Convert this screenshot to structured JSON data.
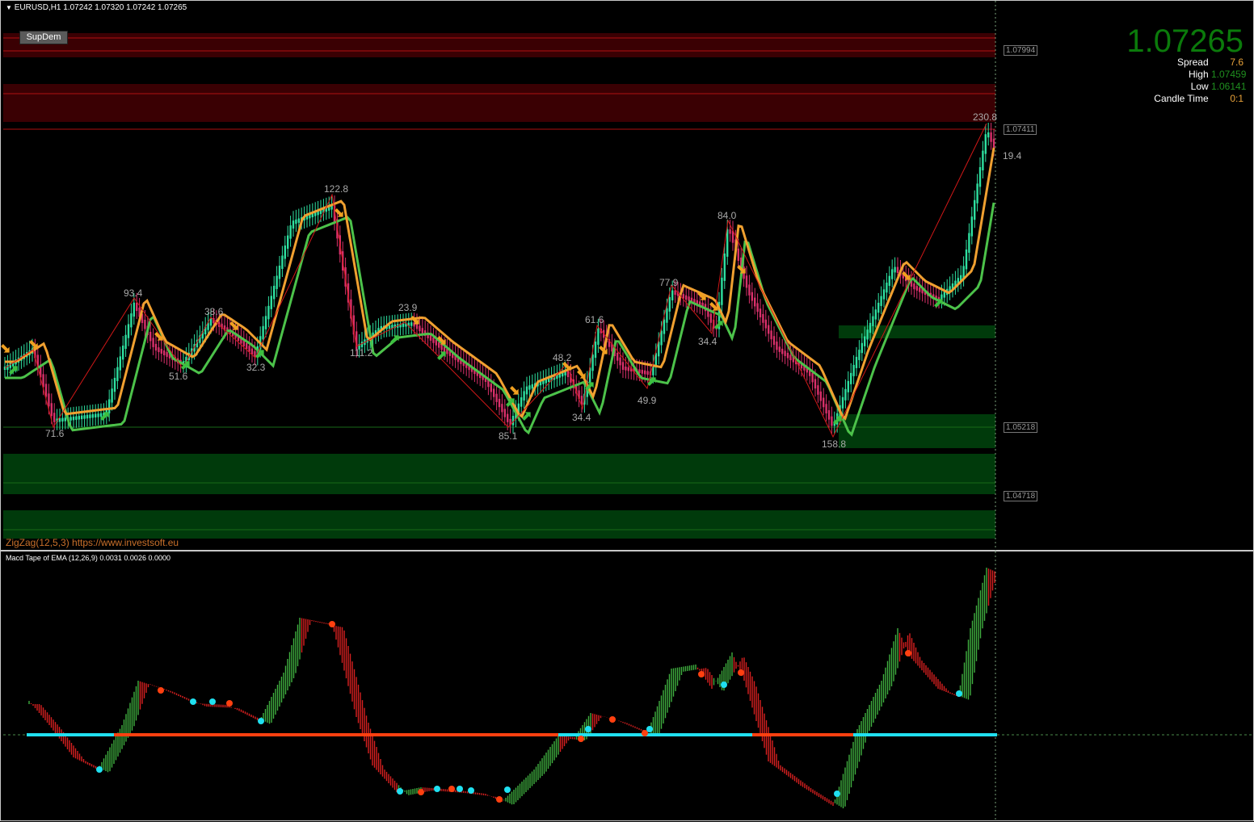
{
  "window": {
    "header": "EURUSD,H1  1.07242 1.07320 1.07242 1.07265",
    "indicator_button": "SupDem",
    "footer": "ZigZag(12,5,3) https://www.investsoft.eu"
  },
  "price_panel": {
    "current_price": "1.07265",
    "rows": [
      {
        "label": "Spread",
        "value": "7.6",
        "color": "#e8a23a"
      },
      {
        "label": "High",
        "value": "1.07459",
        "color": "#1f8f1f"
      },
      {
        "label": "Low",
        "value": "1.06141",
        "color": "#1f8f1f"
      },
      {
        "label": "Candle Time",
        "value": "0:1",
        "color": "#e8a23a"
      }
    ]
  },
  "price_tags": [
    "1.07994",
    "1.07411",
    "1.05218",
    "1.04718"
  ],
  "zigzag_labels": [
    "93.4",
    "71.6",
    "51.6",
    "38.6",
    "32.3",
    "122.8",
    "111.2",
    "23.9",
    "85.1",
    "48.2",
    "61.6",
    "34.4",
    "49.9",
    "77.9",
    "34.4",
    "84.0",
    "158.8",
    "230.8",
    "19.4"
  ],
  "subwindow": {
    "title": "Macd Tape of EMA (12,26,9) 0.0031 0.0026 0.0000"
  },
  "colors": {
    "supply_zone": "#3a0003",
    "demand_zone": "#003a0b",
    "bull_candle": "#2ee0a0",
    "bear_candle": "#d8306a",
    "fast_ma": "#f0a030",
    "slow_ma": "#4cc24a",
    "zigzag": "#d01818",
    "macd_up": "#3fae3f",
    "macd_down": "#d82020",
    "zero_line_up": "#20e0f0",
    "zero_line_down": "#ff4010"
  }
}
